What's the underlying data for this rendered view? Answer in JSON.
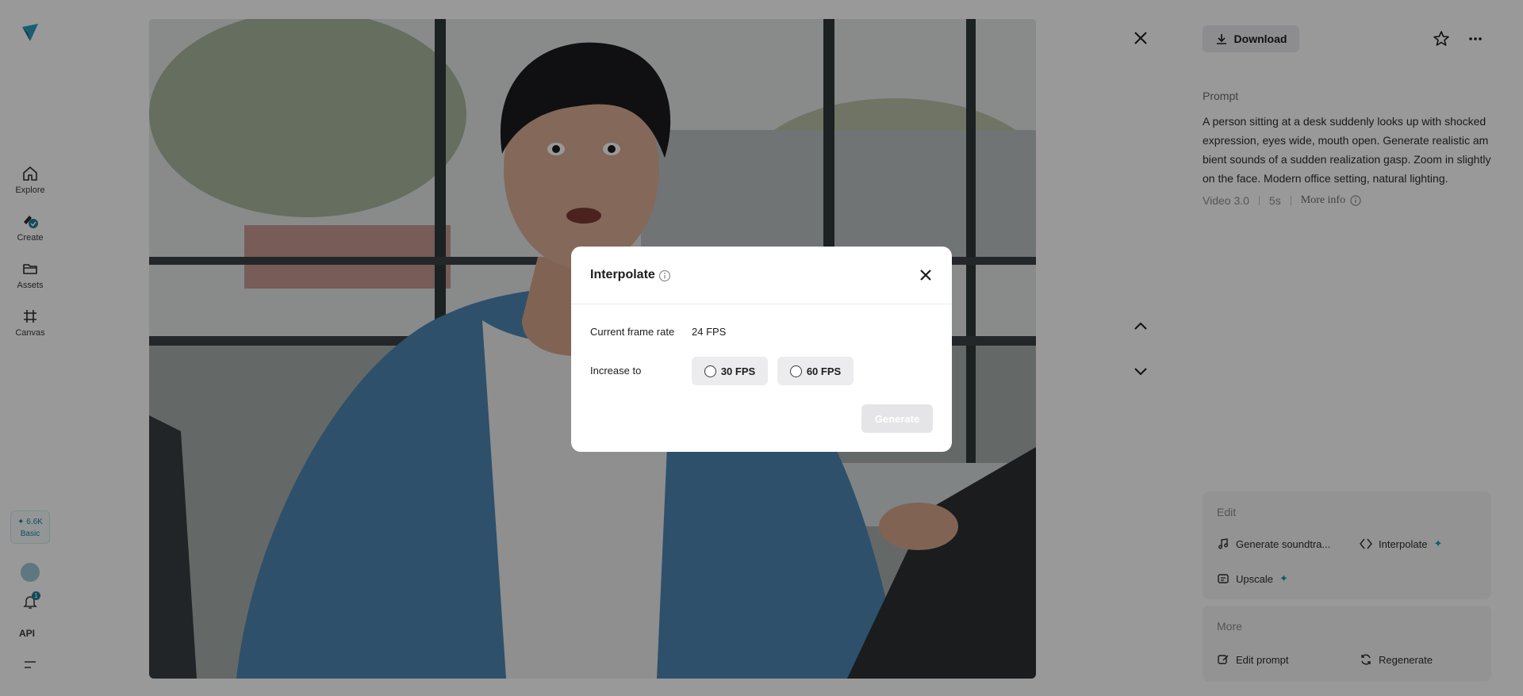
{
  "nav": {
    "items": [
      {
        "label": "Explore",
        "icon": "home-icon"
      },
      {
        "label": "Create",
        "icon": "create-icon"
      },
      {
        "label": "Assets",
        "icon": "folder-icon"
      },
      {
        "label": "Canvas",
        "icon": "canvas-icon"
      }
    ],
    "credits": {
      "amount": "✦ 6.6K",
      "plan": "Basic"
    },
    "notification_count": "1",
    "api_label": "API"
  },
  "toolbar": {
    "download_label": "Download"
  },
  "details": {
    "prompt_label": "Prompt",
    "prompt_text": "A person sitting at a desk suddenly looks up with shocked expression, eyes wide, mouth open. Generate realistic ambient sounds of a sudden realization gasp. Zoom in slightly on the face. Modern office setting, natural lighting.",
    "model": "Video 3.0",
    "duration": "5s",
    "more_info_label": "More info"
  },
  "edit": {
    "title": "Edit",
    "actions": [
      {
        "label": "Generate soundtra...",
        "icon": "music-note-icon",
        "premium": false
      },
      {
        "label": "Interpolate",
        "icon": "interpolate-icon",
        "premium": true
      },
      {
        "label": "Upscale",
        "icon": "upscale-icon",
        "premium": true
      }
    ],
    "premium_glyph": "✦"
  },
  "more": {
    "title": "More",
    "actions": [
      {
        "label": "Edit prompt",
        "icon": "edit-icon"
      },
      {
        "label": "Regenerate",
        "icon": "regenerate-icon"
      }
    ]
  },
  "modal": {
    "title": "Interpolate",
    "current_label": "Current frame rate",
    "current_value": "24 FPS",
    "increase_label": "Increase to",
    "options": [
      "30 FPS",
      "60 FPS"
    ],
    "generate_label": "Generate"
  },
  "colors": {
    "accent": "#1d7f98",
    "overlay": "rgba(0,0,0,0.40)"
  }
}
